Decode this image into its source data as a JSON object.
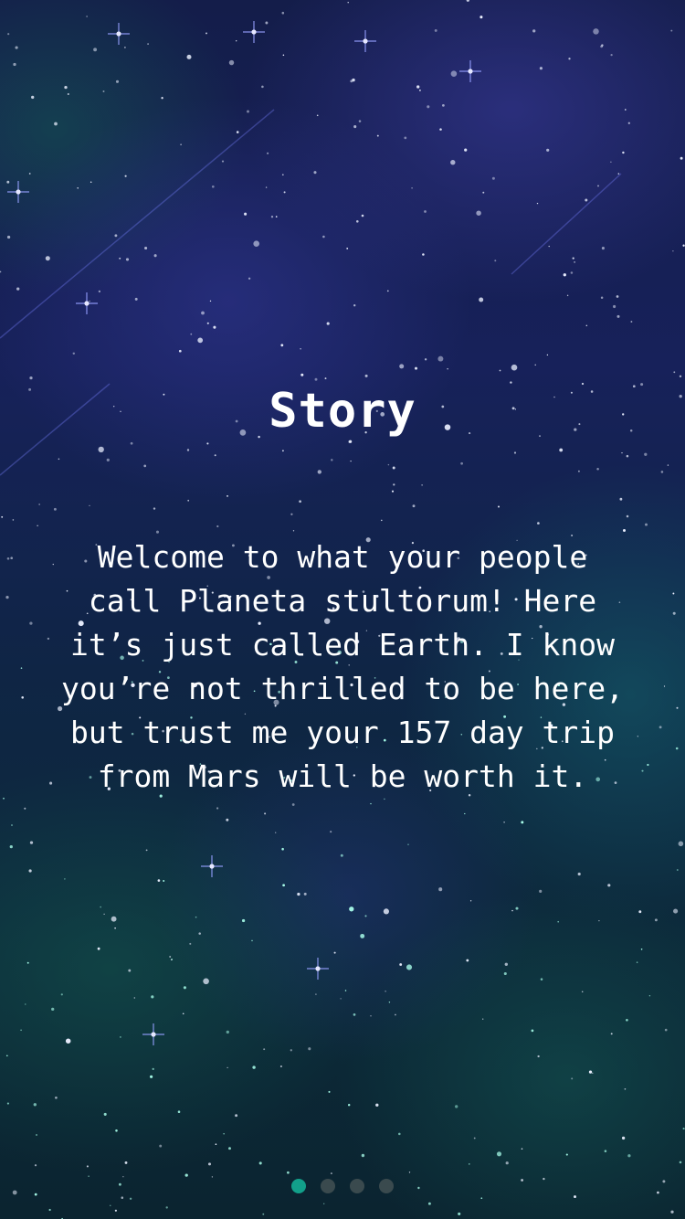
{
  "screen": {
    "title": "Story",
    "body": "Welcome to what your people call Planeta stultorum! Here it’s just called Earth. I know you’re not thrilled to be here, but trust me your 157 day trip from Mars will be worth it."
  },
  "pager": {
    "page_count": 4,
    "active_index": 0,
    "active_color": "#12a08a",
    "inactive_color": "#3a4a4e"
  },
  "background": {
    "description_color_top": "#17215a",
    "description_color_bottom": "#0b2430"
  }
}
